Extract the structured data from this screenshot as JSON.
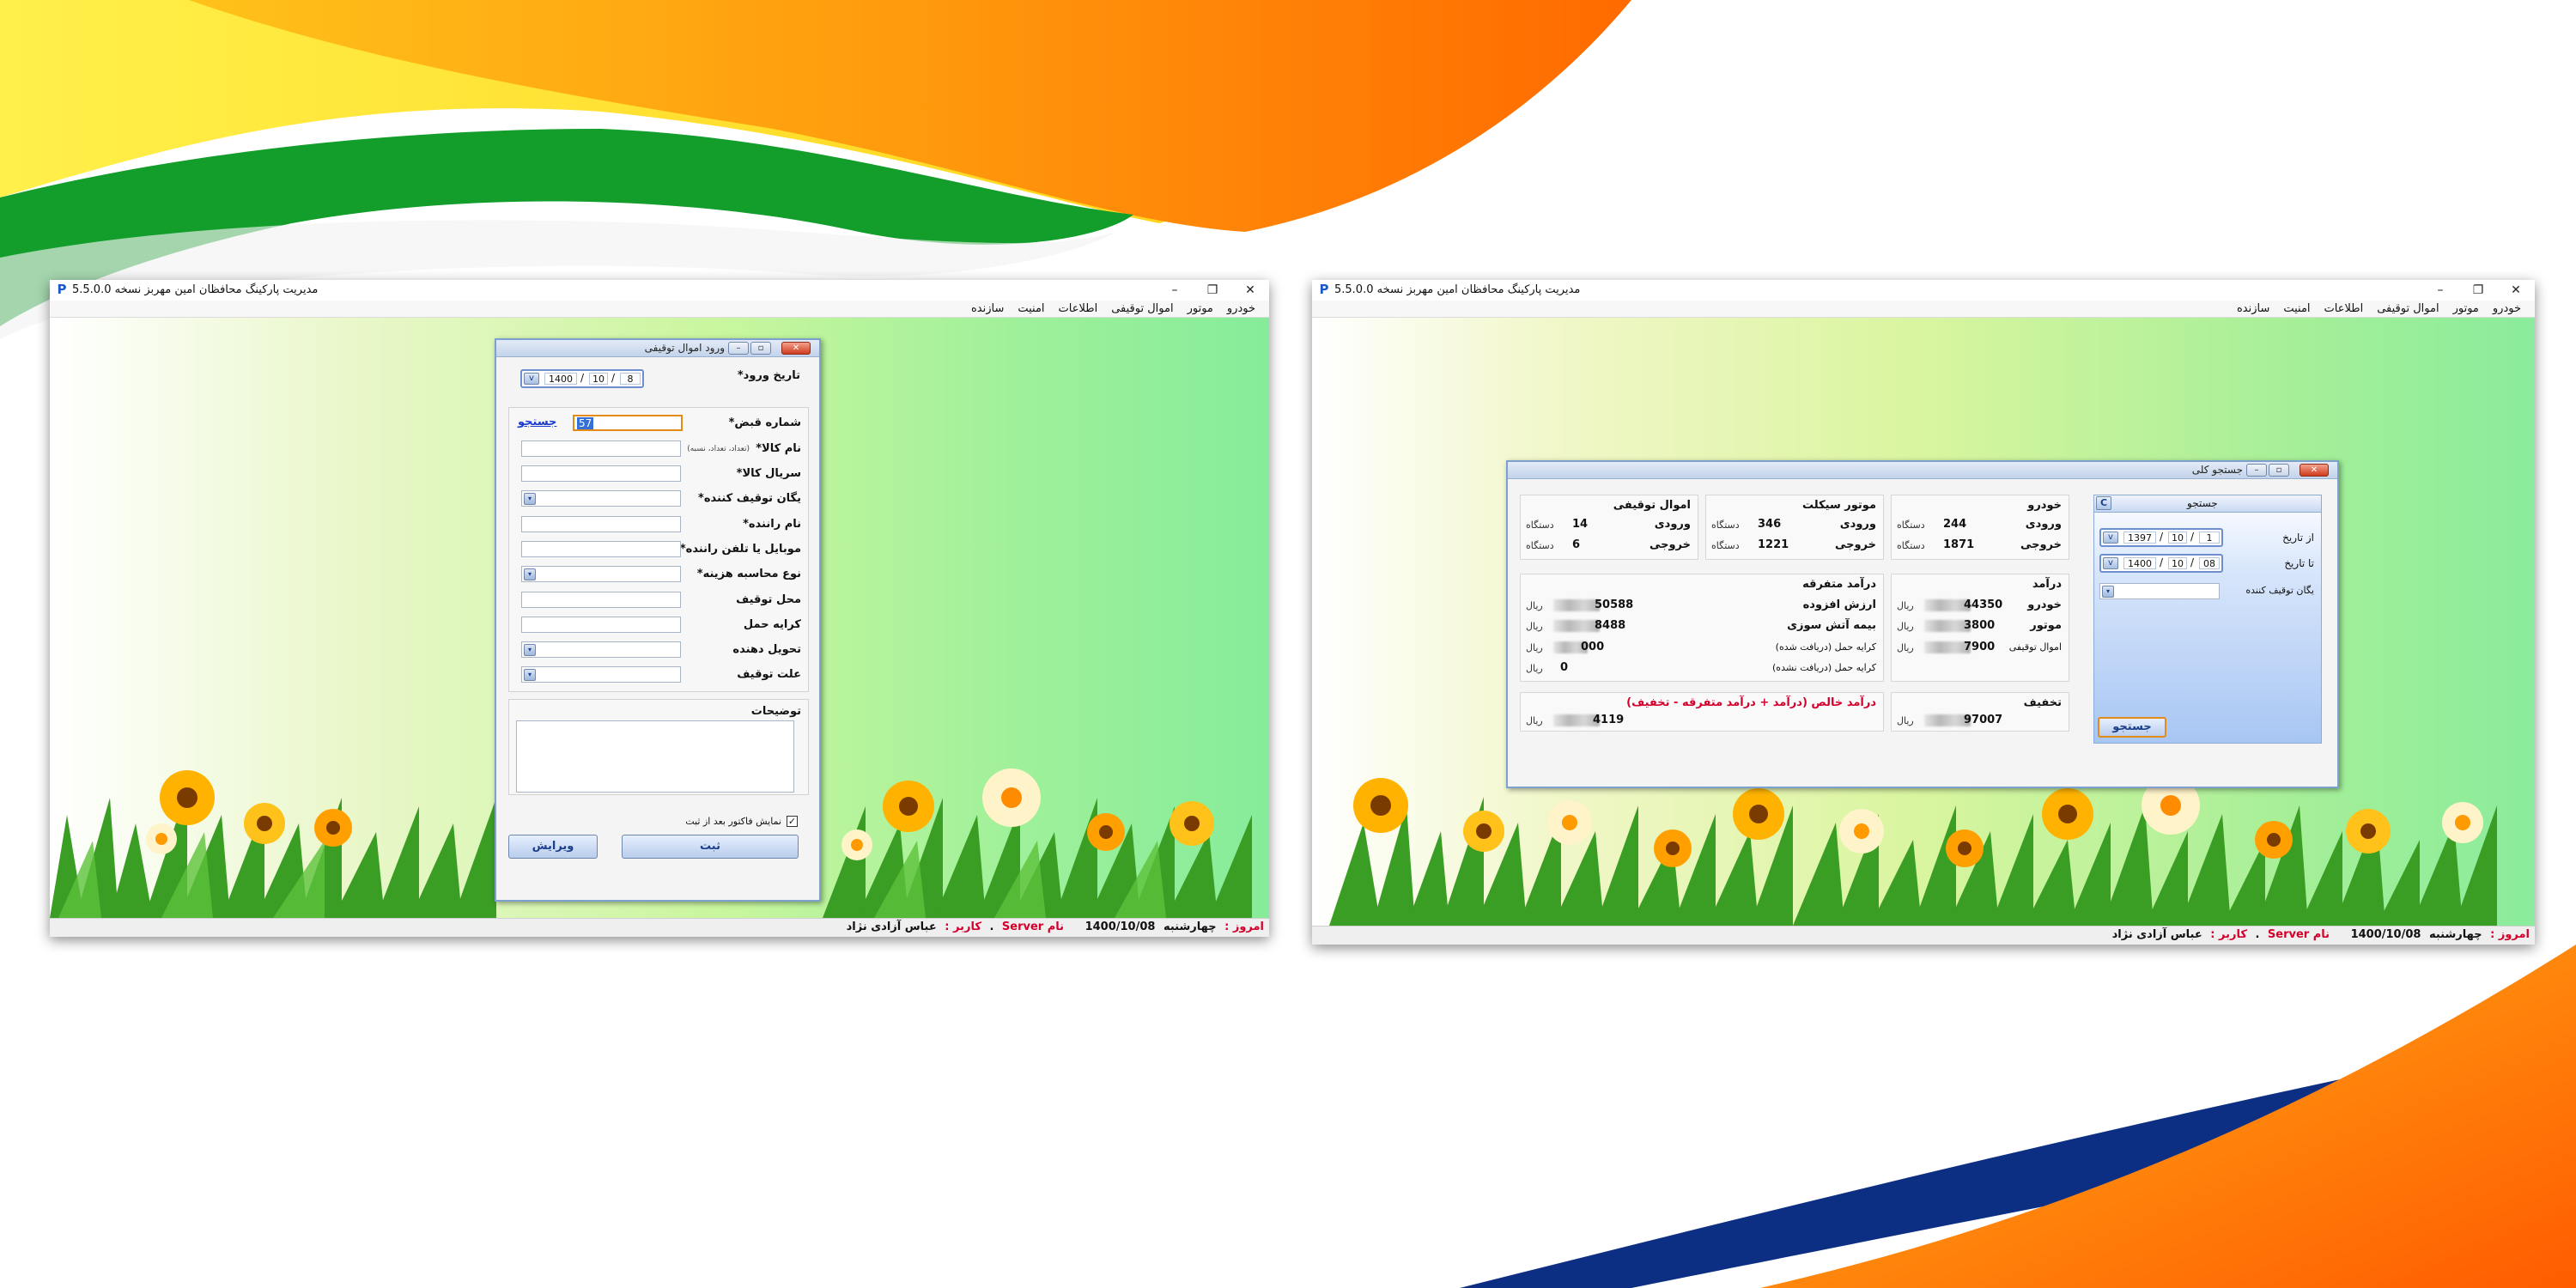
{
  "app": {
    "title": "مدیریت پارکینگ محافظان امین مهربز نسخه 5.5.0.0",
    "icon_letter": "P",
    "menu": [
      "خودرو",
      "موتور",
      "اموال توقیفی",
      "اطلاعات",
      "امنیت",
      "سازنده"
    ]
  },
  "status": {
    "today_label": "امروز :",
    "weekday": "چهارشنبه",
    "date": "1400/10/08",
    "server_label": "نام Server",
    "server_value": ".",
    "user_label": "کاربر :",
    "user_name": "عباس آزادی نژاد"
  },
  "entry_dialog": {
    "title": "ورود اموال توقیفی",
    "entry_date_label": "تاریخ ورود*",
    "entry_date": {
      "year": "1400",
      "month": "10",
      "day": "8",
      "sep": "/",
      "dropdown": "v"
    },
    "receipt_label": "شماره قبض*",
    "receipt_value": "57",
    "search_link": "جستجو",
    "item_name_label": "نام کالا*",
    "item_name_hint": "(تعداد، تعداد، نسبه)",
    "item_serial_label": "سریال کالا*",
    "seizing_unit_label": "یگان توقیف کننده*",
    "driver_name_label": "نام راننده*",
    "driver_mobile_label": "موبایل یا تلفن راننده*",
    "cost_calc_label": "نوع محاسبه هزینه*",
    "seizure_place_label": "محل توقیف",
    "transport_fee_label": "کرایه حمل",
    "deliverer_label": "تحویل دهنده",
    "seizure_reason_label": "علت توقیف",
    "notes_label": "توضیحات",
    "show_invoice_label": "نمایش فاکتور بعد از ثبت",
    "show_invoice_checked": "✓",
    "register_button": "ثبت",
    "edit_button": "ویرایش",
    "dropdown_glyph": "▾"
  },
  "search_dialog": {
    "title": "جستجو کلی",
    "search_pane_title": "جستجو",
    "clear_button": "C",
    "from_date_label": "از تاریخ",
    "from_date": {
      "year": "1397",
      "month": "10",
      "day": "1"
    },
    "to_date_label": "تا تاریخ",
    "to_date": {
      "year": "1400",
      "month": "10",
      "day": "08"
    },
    "date_sep": "/",
    "date_dropdown": "v",
    "unit_label": "یگان توقیف کننده",
    "search_button": "جستجو",
    "entries_label": "ورودی",
    "exits_label": "خروجی",
    "device_unit": "دستگاه",
    "rial_unit": "ریال",
    "car": {
      "title": "خودرو",
      "entries": "244",
      "exits": "1871"
    },
    "motorcycle": {
      "title": "موتور سیکلت",
      "entries": "346",
      "exits": "1221"
    },
    "seized": {
      "title": "اموال توقیفی",
      "entries": "14",
      "exits": "6"
    },
    "income": {
      "title": "درآمد",
      "rows": [
        {
          "label": "خودرو",
          "value": "44350"
        },
        {
          "label": "موتور",
          "value": "3800"
        },
        {
          "label": "اموال توقیفی",
          "value": "7900"
        }
      ]
    },
    "misc_income": {
      "title": "درآمد متفرقه",
      "rows": [
        {
          "label": "ارزش افزوده",
          "value": "50588"
        },
        {
          "label": "بیمه آتش سوزی",
          "value": "8488"
        },
        {
          "label": "کرایه حمل (دریافت شده)",
          "value": "000"
        },
        {
          "label": "کرایه حمل (دریافت نشده)",
          "value": "0"
        }
      ]
    },
    "discount": {
      "title": "تخفیف",
      "value": "97007"
    },
    "net_income": {
      "title": "درآمد خالص (درآمد + درآمد متفرقه - تخفیف)",
      "value": "4119"
    }
  },
  "colors": {
    "accent_red": "#d4002c",
    "link_blue": "#1a3bd0",
    "focus_orange": "#e48a16"
  }
}
